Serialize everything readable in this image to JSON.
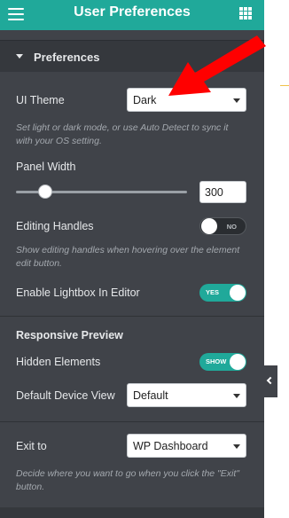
{
  "header": {
    "title": "User Preferences",
    "menu_icon": "hamburger-icon",
    "apps_icon": "grid-icon",
    "color": "#20a99a"
  },
  "section": {
    "label": "Preferences",
    "icon": "caret-down-icon"
  },
  "ui_theme": {
    "label": "UI Theme",
    "value": "Dark",
    "description": "Set light or dark mode, or use Auto Detect to sync it with your OS setting."
  },
  "panel_width": {
    "label": "Panel Width",
    "value": "300",
    "slider_fraction": 0.17
  },
  "editing_handles": {
    "label": "Editing Handles",
    "toggle_text": "NO",
    "state": "off",
    "description": "Show editing handles when hovering over the element edit button."
  },
  "lightbox": {
    "label": "Enable Lightbox In Editor",
    "toggle_text": "YES",
    "state": "on"
  },
  "responsive": {
    "title": "Responsive Preview",
    "hidden_elements": {
      "label": "Hidden Elements",
      "toggle_text": "SHOW",
      "state": "on"
    },
    "default_device": {
      "label": "Default Device View",
      "value": "Default"
    }
  },
  "exit": {
    "label": "Exit to",
    "value": "WP Dashboard",
    "description": "Decide where you want to go when you click the \"Exit\" button."
  },
  "colors": {
    "panel": "#404349",
    "accent": "#20a99a",
    "annotation_arrow": "#ff0000"
  }
}
